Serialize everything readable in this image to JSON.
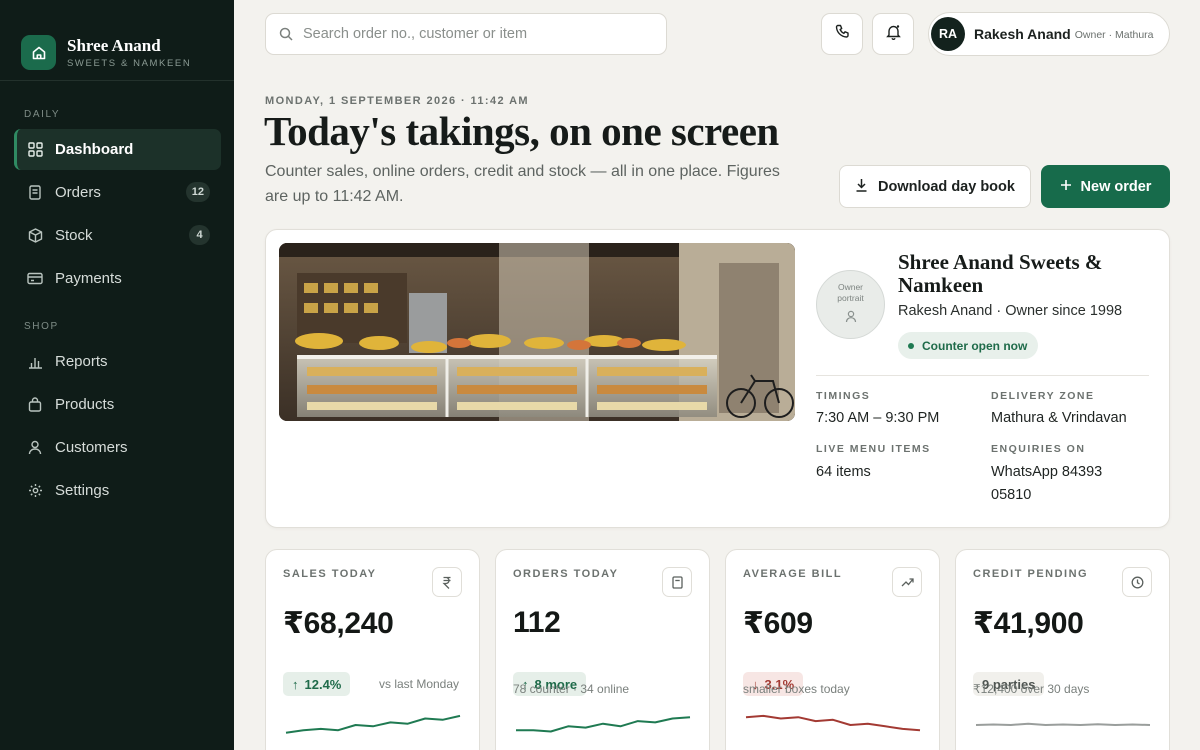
{
  "brand": {
    "name": "Shree Anand",
    "tagline": "SWEETS & NAMKEEN",
    "icon": "home-icon"
  },
  "sidebar": {
    "daily_label": "DAILY",
    "daily_items": [
      {
        "label": "Dashboard",
        "icon": "grid-icon",
        "active": true,
        "badge": ""
      },
      {
        "label": "Orders",
        "icon": "receipt-icon",
        "badge": "12"
      },
      {
        "label": "Stock",
        "icon": "box-icon",
        "badge": "4"
      },
      {
        "label": "Payments",
        "icon": "card-icon",
        "badge": ""
      }
    ],
    "shop_label": "SHOP",
    "shop_items": [
      {
        "label": "Reports",
        "icon": "bar-chart-icon"
      },
      {
        "label": "Products",
        "icon": "bag-icon"
      },
      {
        "label": "Customers",
        "icon": "user-icon"
      },
      {
        "label": "Settings",
        "icon": "gear-icon"
      }
    ]
  },
  "header": {
    "search_placeholder": "Search order no., customer or item",
    "phone_icon": "phone-icon",
    "bell_icon": "bell-icon",
    "user": {
      "initials": "RA",
      "name": "Rakesh Anand",
      "role": "Owner · Mathura"
    }
  },
  "page": {
    "date": "MONDAY, 1 SEPTEMBER 2026 · 11:42 AM",
    "title": "Today's takings, on one screen",
    "subtitle": "Counter sales, online orders, credit and stock — all in one place. Figures are up to 11:42 AM.",
    "download_label": "Download day book",
    "new_order_label": "New order"
  },
  "store": {
    "portrait_label": "Owner portrait",
    "name": "Shree Anand Sweets & Namkeen",
    "owner_line": "Rakesh Anand · Owner since 1998",
    "status": "Counter open now",
    "timings_label": "TIMINGS",
    "timings": "7:30 AM – 9:30 PM",
    "zone_label": "DELIVERY ZONE",
    "zone": "Mathura & Vrindavan",
    "menu_label": "LIVE MENU ITEMS",
    "menu": "64 items",
    "enquiries_label": "ENQUIRIES ON",
    "enquiries": "WhatsApp 84393 05810"
  },
  "kpis": [
    {
      "label": "SALES TODAY",
      "icon": "rupee-icon",
      "value": "₹68,240",
      "chip": "12.4%",
      "chip_type": "up",
      "note": "vs last Monday",
      "spark": [
        0.2,
        0.3,
        0.35,
        0.3,
        0.5,
        0.45,
        0.6,
        0.55,
        0.75,
        0.7,
        0.85
      ],
      "color": "#1f7a52"
    },
    {
      "label": "ORDERS TODAY",
      "icon": "receipt-icon",
      "value": "112",
      "chip": "8 more",
      "chip_type": "up",
      "note": "78 counter · 34 online",
      "spark": [
        0.3,
        0.3,
        0.25,
        0.45,
        0.4,
        0.55,
        0.45,
        0.65,
        0.6,
        0.75,
        0.8
      ],
      "color": "#1f7a52"
    },
    {
      "label": "AVERAGE BILL",
      "icon": "trend-up-icon",
      "value": "₹609",
      "chip": "3.1%",
      "chip_type": "down",
      "note": "smaller boxes today",
      "spark": [
        0.8,
        0.85,
        0.75,
        0.8,
        0.65,
        0.7,
        0.5,
        0.55,
        0.45,
        0.35,
        0.3
      ],
      "color": "#a33a33"
    },
    {
      "label": "CREDIT PENDING",
      "icon": "clock-icon",
      "value": "₹41,900",
      "chip": "9 parties",
      "chip_type": "neutral",
      "note": "₹12,400 over 30 days",
      "spark": [
        0.5,
        0.52,
        0.5,
        0.55,
        0.5,
        0.52,
        0.5,
        0.53,
        0.5,
        0.52,
        0.5
      ],
      "color": "#9a9e9c"
    }
  ]
}
